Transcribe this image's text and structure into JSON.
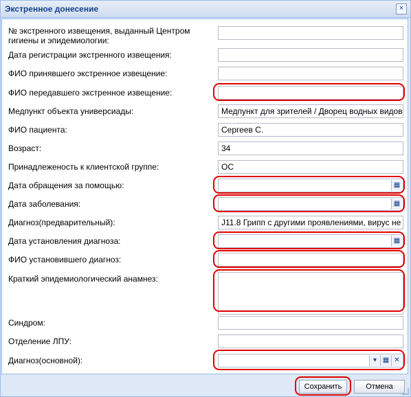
{
  "window": {
    "title": "Экстренное донесение",
    "close_glyph": "×"
  },
  "form": {
    "fields": [
      {
        "label": "№ экстренного извещения, выданный Центром гигиены и эпидемиологии:",
        "value": ""
      },
      {
        "label": "Дата регистрации экстренного извещения:",
        "value": ""
      },
      {
        "label": "ФИО принявшего экстренное извещение:",
        "value": ""
      },
      {
        "label": "ФИО передавшего экстренное извещение:",
        "value": ""
      },
      {
        "label": "Медпункт объекта универсиады:",
        "value": "Медпункт для зрителей / Дворец водных видов"
      },
      {
        "label": "ФИО пациента:",
        "value": "Сергеев С."
      },
      {
        "label": "Возраст:",
        "value": "34"
      },
      {
        "label": "Принадлеженость к клиентской группе:",
        "value": "ОС"
      },
      {
        "label": "Дата обращения за помощью:",
        "value": ""
      },
      {
        "label": "Дата заболевания:",
        "value": ""
      },
      {
        "label": "Диагноз(предварительный):",
        "value": "J11.8 Грипп с другими проявлениями, вирус не"
      },
      {
        "label": "Дата установления диагноза:",
        "value": ""
      },
      {
        "label": "ФИО установившего диагноз:",
        "value": ""
      },
      {
        "label": "Краткий эпидемиологический анамнез:",
        "value": ""
      },
      {
        "label": "Синдром:",
        "value": ""
      },
      {
        "label": "Отделение ЛПУ:",
        "value": ""
      },
      {
        "label": "Диагноз(основной):",
        "value": ""
      }
    ]
  },
  "icons": {
    "calendar": "calendar-icon",
    "dropdown": "chevron-down-icon",
    "clear": "clear-icon"
  },
  "buttons": {
    "save": "Сохранить",
    "cancel": "Отмена"
  },
  "colors": {
    "highlight": "#e10000",
    "header_text": "#15428b",
    "window_border": "#99bbe8"
  }
}
